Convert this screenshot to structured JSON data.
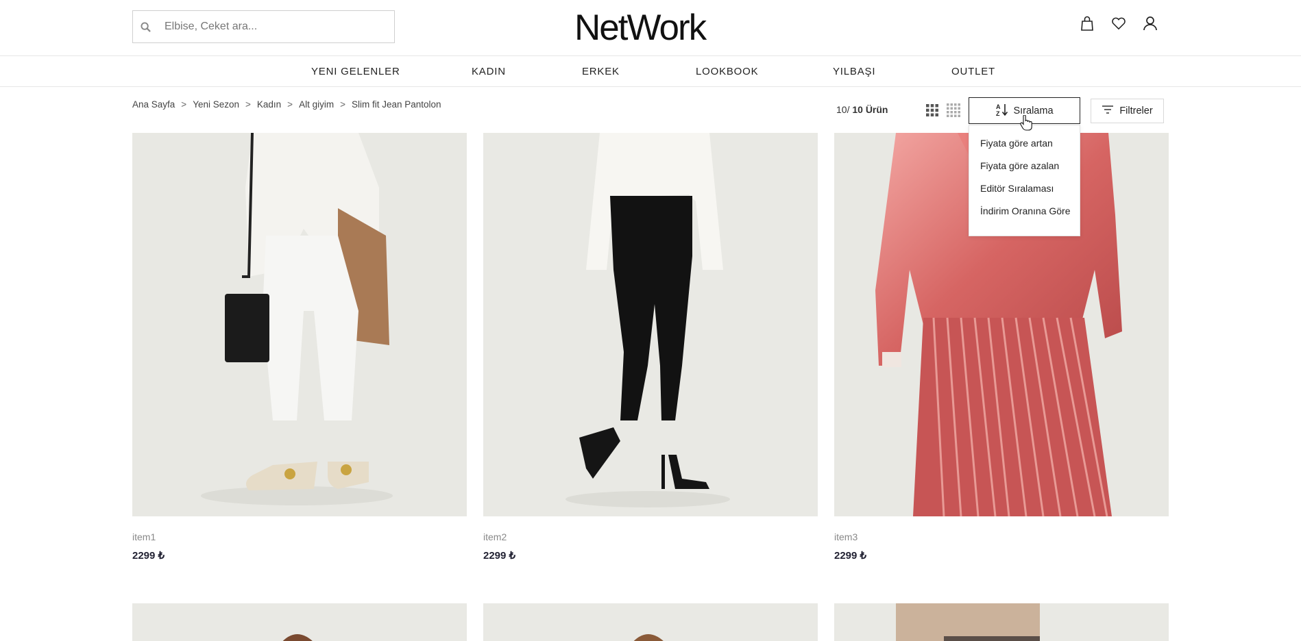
{
  "header": {
    "search_placeholder": "Elbise, Ceket ara...",
    "logo": "NetWork",
    "icons": [
      "bag-icon",
      "heart-icon",
      "user-icon"
    ]
  },
  "nav": {
    "items": [
      "YENI GELENLER",
      "KADIN",
      "ERKEK",
      "LOOKBOOK",
      "YILBAŞI",
      "OUTLET"
    ]
  },
  "breadcrumb": {
    "items": [
      "Ana Sayfa",
      "Yeni Sezon",
      "Kadın",
      "Alt giyim",
      "Slim fit Jean Pantolon"
    ],
    "separator": ">"
  },
  "toolbar": {
    "count_prefix": "10/",
    "count_total": "10 Ürün",
    "sort_label": "Sıralama",
    "filter_label": "Filtreler"
  },
  "sort_options": [
    "Fiyata göre artan",
    "Fiyata göre azalan",
    "Editör Sıralaması",
    "İndirim Oranına Göre"
  ],
  "products": [
    {
      "name": "item1",
      "price": "2299 ₺"
    },
    {
      "name": "item2",
      "price": "2299 ₺"
    },
    {
      "name": "item3",
      "price": "2299 ₺"
    }
  ],
  "colors": {
    "background": "#ffffff",
    "text": "#222222",
    "price": "#223344",
    "border": "#cfcfcf"
  }
}
